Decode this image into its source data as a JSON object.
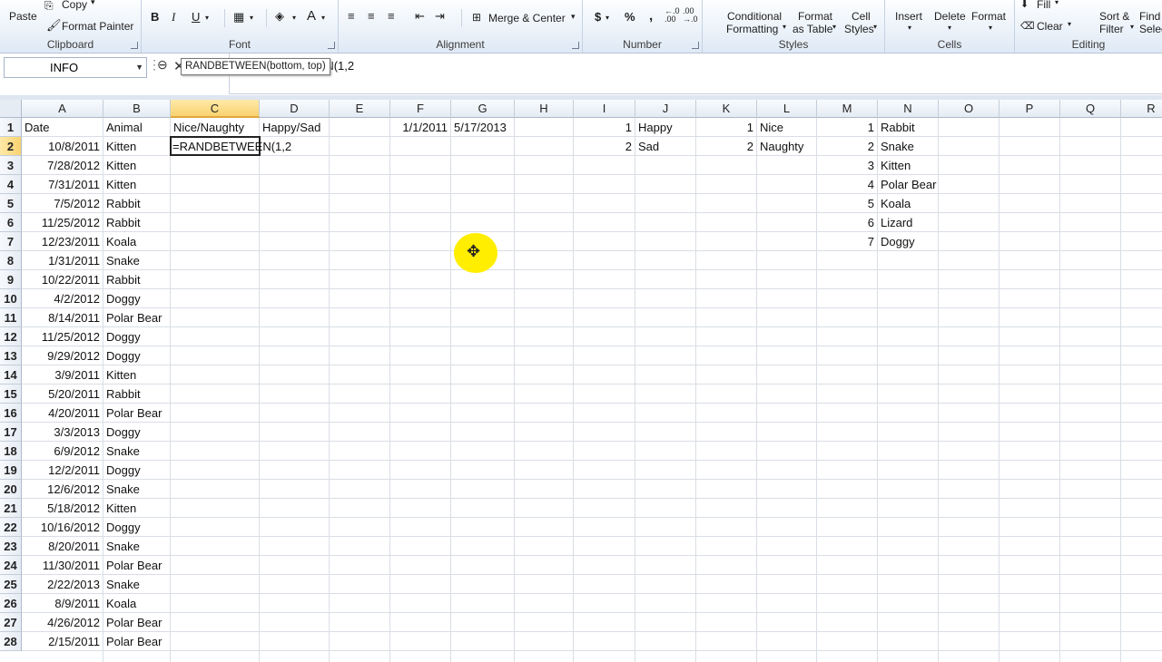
{
  "ribbon": {
    "clipboard": {
      "paste": "Paste",
      "copy": "Copy",
      "format_painter": "Format Painter",
      "label": "Clipboard"
    },
    "font": {
      "bold": "B",
      "italic": "I",
      "underline": "U",
      "font_color": "A",
      "label": "Font"
    },
    "alignment": {
      "merge_center": "Merge & Center",
      "label": "Alignment"
    },
    "number": {
      "currency": "$",
      "percent": "%",
      "comma": ",",
      "inc_decimal": "←.0 .00",
      "dec_decimal": ".00 →.0",
      "label": "Number"
    },
    "styles": {
      "conditional_1": "Conditional",
      "conditional_2": "Formatting",
      "table_1": "Format",
      "table_2": "as Table",
      "cell_1": "Cell",
      "cell_2": "Styles",
      "label": "Styles"
    },
    "cells": {
      "insert": "Insert",
      "delete": "Delete",
      "format": "Format",
      "label": "Cells"
    },
    "editing": {
      "fill": "Fill",
      "clear": "Clear",
      "sort_1": "Sort &",
      "sort_2": "Filter",
      "find_1": "Find",
      "find_2": "Selec",
      "label": "Editing"
    }
  },
  "formula_bar": {
    "name_box": "INFO",
    "cancel": "✕",
    "enter": "✓",
    "fx": "fx",
    "formula": "=RANDBETWEEN(1,2"
  },
  "grid": {
    "columns": [
      "A",
      "B",
      "C",
      "D",
      "E",
      "F",
      "G",
      "H",
      "I",
      "J",
      "K",
      "L",
      "M",
      "N",
      "O",
      "P",
      "Q",
      "R"
    ],
    "selected_column": "C",
    "rows": [
      "1",
      "2",
      "3",
      "4",
      "5",
      "6",
      "7",
      "8",
      "9",
      "10",
      "11",
      "12",
      "13",
      "14",
      "15",
      "16",
      "17",
      "18",
      "19",
      "20",
      "21",
      "22",
      "23",
      "24",
      "25",
      "26",
      "27",
      "28"
    ],
    "selected_row": "2",
    "headers": {
      "a": "Date",
      "b": "Animal",
      "c": "Nice/Naughty",
      "d": "Happy/Sad",
      "f": "1/1/2011",
      "g": "5/17/2013"
    },
    "active_cell_text": "=RANDBETWEEN(1,2",
    "tooltip": "RANDBETWEEN(bottom, top)",
    "data_rows": [
      {
        "date": "10/8/2011",
        "animal": "Kitten"
      },
      {
        "date": "7/28/2012",
        "animal": "Kitten"
      },
      {
        "date": "7/31/2011",
        "animal": "Kitten"
      },
      {
        "date": "7/5/2012",
        "animal": "Rabbit"
      },
      {
        "date": "11/25/2012",
        "animal": "Rabbit"
      },
      {
        "date": "12/23/2011",
        "animal": "Koala"
      },
      {
        "date": "1/31/2011",
        "animal": "Snake"
      },
      {
        "date": "10/22/2011",
        "animal": "Rabbit"
      },
      {
        "date": "4/2/2012",
        "animal": "Doggy"
      },
      {
        "date": "8/14/2011",
        "animal": "Polar Bear"
      },
      {
        "date": "11/25/2012",
        "animal": "Doggy"
      },
      {
        "date": "9/29/2012",
        "animal": "Doggy"
      },
      {
        "date": "3/9/2011",
        "animal": "Kitten"
      },
      {
        "date": "5/20/2011",
        "animal": "Rabbit"
      },
      {
        "date": "4/20/2011",
        "animal": "Polar Bear"
      },
      {
        "date": "3/3/2013",
        "animal": "Doggy"
      },
      {
        "date": "6/9/2012",
        "animal": "Snake"
      },
      {
        "date": "12/2/2011",
        "animal": "Doggy"
      },
      {
        "date": "12/6/2012",
        "animal": "Snake"
      },
      {
        "date": "5/18/2012",
        "animal": "Kitten"
      },
      {
        "date": "10/16/2012",
        "animal": "Doggy"
      },
      {
        "date": "8/20/2011",
        "animal": "Snake"
      },
      {
        "date": "11/30/2011",
        "animal": "Polar Bear"
      },
      {
        "date": "2/22/2013",
        "animal": "Snake"
      },
      {
        "date": "8/9/2011",
        "animal": "Koala"
      },
      {
        "date": "4/26/2012",
        "animal": "Polar Bear"
      },
      {
        "date": "2/15/2011",
        "animal": "Polar Bear"
      }
    ],
    "happy_sad_lookup": [
      {
        "num": "1",
        "label": "Happy"
      },
      {
        "num": "2",
        "label": "Sad"
      }
    ],
    "nice_naughty_lookup": [
      {
        "num": "1",
        "label": "Nice"
      },
      {
        "num": "2",
        "label": "Naughty"
      }
    ],
    "animal_lookup": [
      {
        "num": "1",
        "label": "Rabbit"
      },
      {
        "num": "2",
        "label": "Snake"
      },
      {
        "num": "3",
        "label": "Kitten"
      },
      {
        "num": "4",
        "label": "Polar Bear"
      },
      {
        "num": "5",
        "label": "Koala"
      },
      {
        "num": "6",
        "label": "Lizard"
      },
      {
        "num": "7",
        "label": "Doggy"
      }
    ]
  },
  "icons": {
    "copy": "copy-icon",
    "format_painter": "paintbrush-icon",
    "cursor": "move-cursor-icon"
  }
}
